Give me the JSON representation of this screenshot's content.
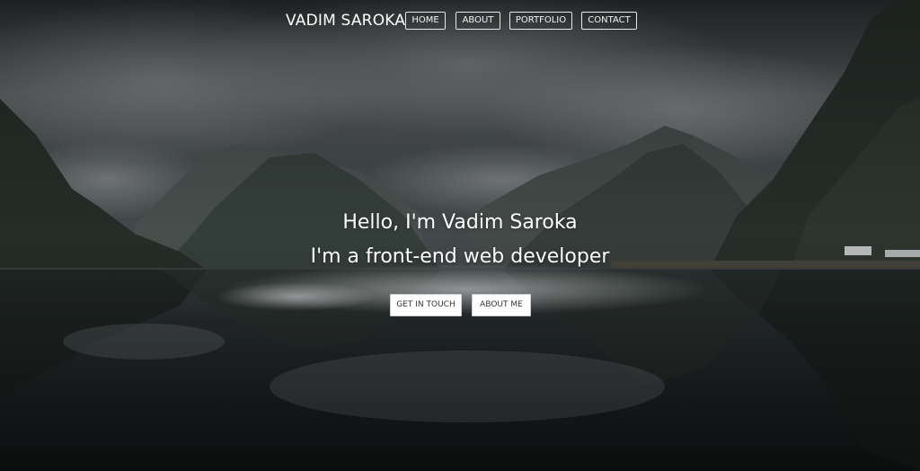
{
  "header": {
    "brand": "VADIM SAROKA",
    "nav": [
      {
        "label": "HOME"
      },
      {
        "label": "ABOUT"
      },
      {
        "label": "PORTFOLIO"
      },
      {
        "label": "CONTACT"
      }
    ]
  },
  "hero": {
    "greeting": "Hello, I'm Vadim Saroka",
    "subtitle": "I'm a front-end web developer",
    "buttons": [
      {
        "label": "GET IN TOUCH"
      },
      {
        "label": "ABOUT ME"
      }
    ],
    "background_colors": {
      "sky": "#4a4f52",
      "mountains": "#2e3530",
      "water": "#1f2325",
      "mist": "#b8bcbd"
    }
  }
}
